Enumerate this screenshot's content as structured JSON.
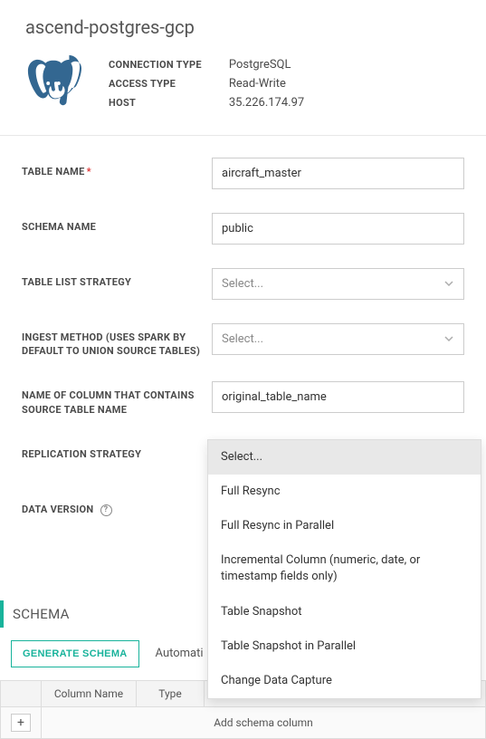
{
  "header": {
    "title": "ascend-postgres-gcp"
  },
  "connInfo": {
    "labels": {
      "type": "CONNECTION TYPE",
      "access": "ACCESS TYPE",
      "host": "HOST"
    },
    "values": {
      "type": "PostgreSQL",
      "access": "Read-Write",
      "host": "35.226.174.97"
    }
  },
  "fields": {
    "tableName": {
      "label": "TABLE NAME",
      "value": "aircraft_master"
    },
    "schemaName": {
      "label": "SCHEMA NAME",
      "value": "public"
    },
    "tableListStrategy": {
      "label": "TABLE LIST STRATEGY",
      "placeholder": "Select..."
    },
    "ingestMethod": {
      "label": "INGEST METHOD (USES SPARK BY DEFAULT TO UNION SOURCE TABLES)",
      "placeholder": "Select..."
    },
    "sourceColumn": {
      "label": "NAME OF COLUMN THAT CONTAINS SOURCE TABLE NAME",
      "value": "original_table_name"
    },
    "replicationStrategy": {
      "label": "REPLICATION STRATEGY",
      "placeholder": "Select..."
    },
    "dataVersion": {
      "label": "DATA VERSION"
    }
  },
  "dropdown": {
    "items": [
      "Select...",
      "Full Resync",
      "Full Resync in Parallel",
      "Incremental Column (numeric, date, or timestamp fields only)",
      "Table Snapshot",
      "Table Snapshot in Parallel",
      "Change Data Capture"
    ]
  },
  "schema": {
    "title": "SCHEMA",
    "generateBtn": "GENERATE SCHEMA",
    "autoText": "Automati",
    "cols": {
      "name": "Column Name",
      "type": "Type"
    },
    "addRow": "Add schema column",
    "plus": "+"
  }
}
